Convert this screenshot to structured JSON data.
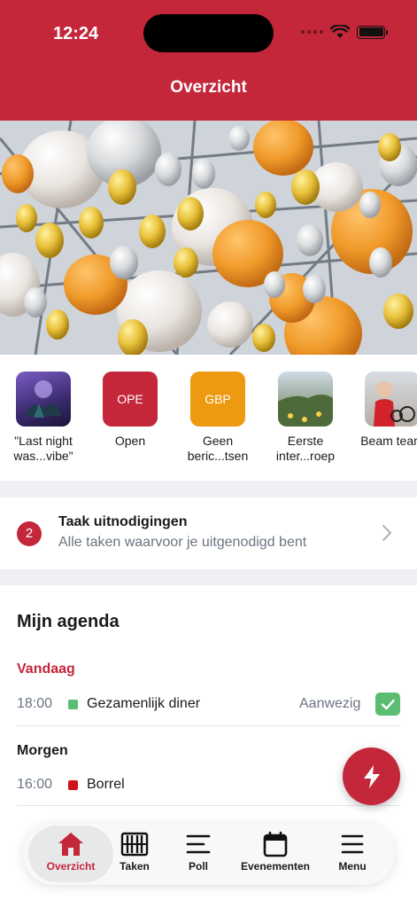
{
  "status_bar": {
    "time": "12:24"
  },
  "header": {
    "title": "Overzicht"
  },
  "stories": [
    {
      "label": "\"Last night was...vibe\"",
      "thumb_text": "",
      "color": "#5a3f8e"
    },
    {
      "label": "Open",
      "thumb_text": "OPE",
      "color": "#c4263a"
    },
    {
      "label": "Geen beric...tsen",
      "thumb_text": "GBP",
      "color": "#ee9a10"
    },
    {
      "label": "Eerste inter...roep",
      "thumb_text": "",
      "color": "#7c8a5a"
    },
    {
      "label": "Beam team",
      "thumb_text": "",
      "color": "#b9b2ad"
    }
  ],
  "invites": {
    "count": "2",
    "title": "Taak uitnodigingen",
    "subtitle": "Alle taken waarvoor je uitgenodigd bent"
  },
  "agenda": {
    "title": "Mijn agenda",
    "today_label": "Vandaag",
    "today_time": "18:00",
    "today_event": "Gezamenlijk diner",
    "today_status": "Aanwezig",
    "tomorrow_label": "Morgen",
    "tomorrow_time": "16:00",
    "tomorrow_event": "Borrel",
    "colors": {
      "today_dot": "#5bbd72",
      "tomorrow_dot": "#d0131b"
    }
  },
  "tabs": [
    {
      "label": "Overzicht",
      "icon": "home-icon",
      "active": true
    },
    {
      "label": "Taken",
      "icon": "abacus-icon"
    },
    {
      "label": "Poll",
      "icon": "lines-icon"
    },
    {
      "label": "Evenementen",
      "icon": "calendar-icon"
    },
    {
      "label": "Menu",
      "icon": "menu-icon"
    }
  ],
  "colors": {
    "brand": "#c4263a",
    "accent_orange": "#ee9a10"
  }
}
